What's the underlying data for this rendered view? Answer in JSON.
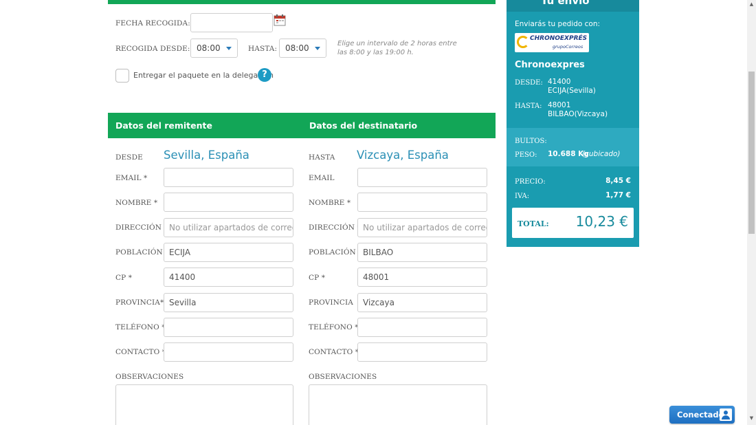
{
  "pickup": {
    "date_label": "FECHA RECOGIDA:",
    "from_label": "RECOGIDA DESDE:",
    "from_value": "08:00",
    "to_label": "HASTA:",
    "to_value": "08:00",
    "hint_line1": "Elige un intervalo de 2 horas entre",
    "hint_line2": "las 8:00 y las 19:00 h.",
    "deliver_label": "Entregar el paquete en la delegación",
    "help_glyph": "?"
  },
  "sections": {
    "sender_title": "Datos del remitente",
    "recipient_title": "Datos del destinatario"
  },
  "sender": {
    "origin_label": "DESDE",
    "origin_value": "Sevilla, España",
    "email_label": "EMAIL *",
    "email_value": "",
    "name_label": "NOMBRE *",
    "name_value": "",
    "address_label": "DIRECCIÓN *",
    "address_placeholder": "No utilizar apartados de correos",
    "city_label": "POBLACIÓN *",
    "city_value": "ECIJA",
    "zip_label": "CP *",
    "zip_value": "41400",
    "province_label": "PROVINCIA*",
    "province_value": "Sevilla",
    "phone_label": "TELÉFONO *",
    "contact_label": "CONTACTO *",
    "notes_label": "OBSERVACIONES"
  },
  "recipient": {
    "dest_label": "HASTA",
    "dest_value": "Vizcaya, España",
    "email_label": "EMAIL",
    "name_label": "NOMBRE *",
    "address_label": "DIRECCIÓN *",
    "address_placeholder": "No utilizar apartados de correos",
    "city_label": "POBLACIÓN *",
    "city_value": "BILBAO",
    "zip_label": "CP *",
    "zip_value": "48001",
    "province_label": "PROVINCIA",
    "province_value": "Vizcaya",
    "phone_label": "TELÉFONO *",
    "contact_label": "CONTACTO *",
    "notes_label": "OBSERVACIONES"
  },
  "summary": {
    "top_label": "Tu envío",
    "ship_with": "Enviarás tu pedido con:",
    "logo_text": "CHRONOEXPRÉS",
    "logo_sub": "grupoCorreos",
    "carrier": "Chronoexpres",
    "from_label": "DESDE:",
    "from_zip": "41400",
    "from_city": "ECIJA(Sevilla)",
    "to_label": "HASTA:",
    "to_zip": "48001",
    "to_city": "BILBAO(Vizcaya)",
    "packages_label": "BULTOS:",
    "weight_label": "PESO:",
    "weight_value": "10.688 Kg",
    "weight_note": "(cubicado)",
    "price_label": "PRECIO:",
    "price_value": "8,45 €",
    "vat_label": "IVA:",
    "vat_value": "1,77 €",
    "total_label": "TOTAL:",
    "total_value": "10,23 €"
  },
  "chat": {
    "label": "Conectado"
  },
  "colors": {
    "green": "#12a657",
    "teal": "#1a9cb0",
    "link_blue": "#2a8fb5"
  }
}
